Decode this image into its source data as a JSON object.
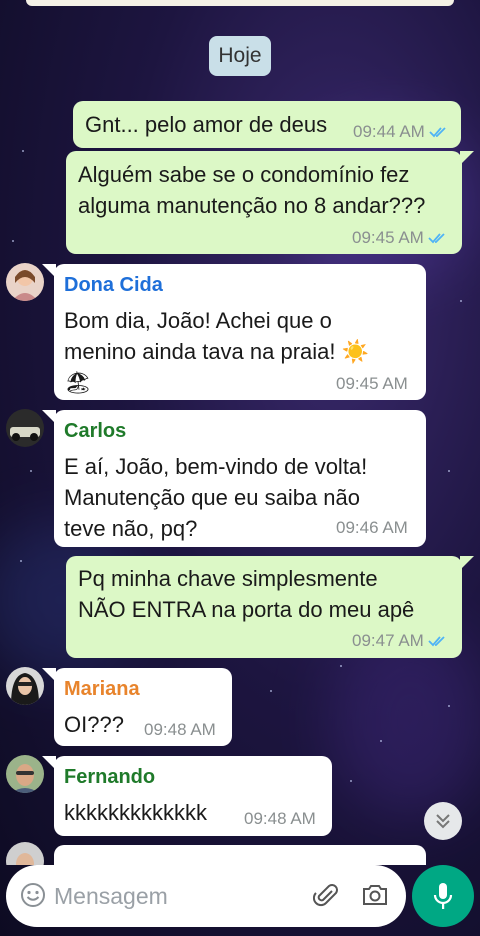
{
  "date_chip": "Hoje",
  "messages": [
    {
      "text": "Gnt... pelo amor de deus",
      "time": "09:44 AM"
    },
    {
      "text": "Alguém sabe se o condomínio fez\nalguma manutenção no 8 andar???",
      "time": "09:45 AM"
    },
    {
      "sender": "Dona Cida",
      "text": "Bom dia, João! Achei que o\nmenino ainda tava na praia! ☀️\n🏖",
      "time": "09:45 AM"
    },
    {
      "sender": "Carlos",
      "text": "E aí, João, bem-vindo de volta!\nManutenção que eu saiba não\nteve não, pq?",
      "time": "09:46 AM"
    },
    {
      "text": "Pq minha chave simplesmente\nNÃO ENTRA na porta do meu apê",
      "time": "09:47 AM"
    },
    {
      "sender": "Mariana",
      "text": "OI???",
      "time": "09:48 AM"
    },
    {
      "sender": "Fernando",
      "text": "kkkkkkkkkkkkk",
      "time": "09:48 AM"
    }
  ],
  "colors": {
    "dona_cida": "#1e6fd9",
    "carlos": "#1f7a2a",
    "mariana": "#e8842c",
    "fernando": "#1f7a2a",
    "outgoing_bubble": "#dcf8c6",
    "read_ticks": "#4fb3f6",
    "mic_button": "#00a884"
  },
  "composer": {
    "placeholder": "Mensagem",
    "icons": [
      "emoji-icon",
      "paperclip-icon",
      "camera-icon",
      "microphone-icon"
    ]
  }
}
